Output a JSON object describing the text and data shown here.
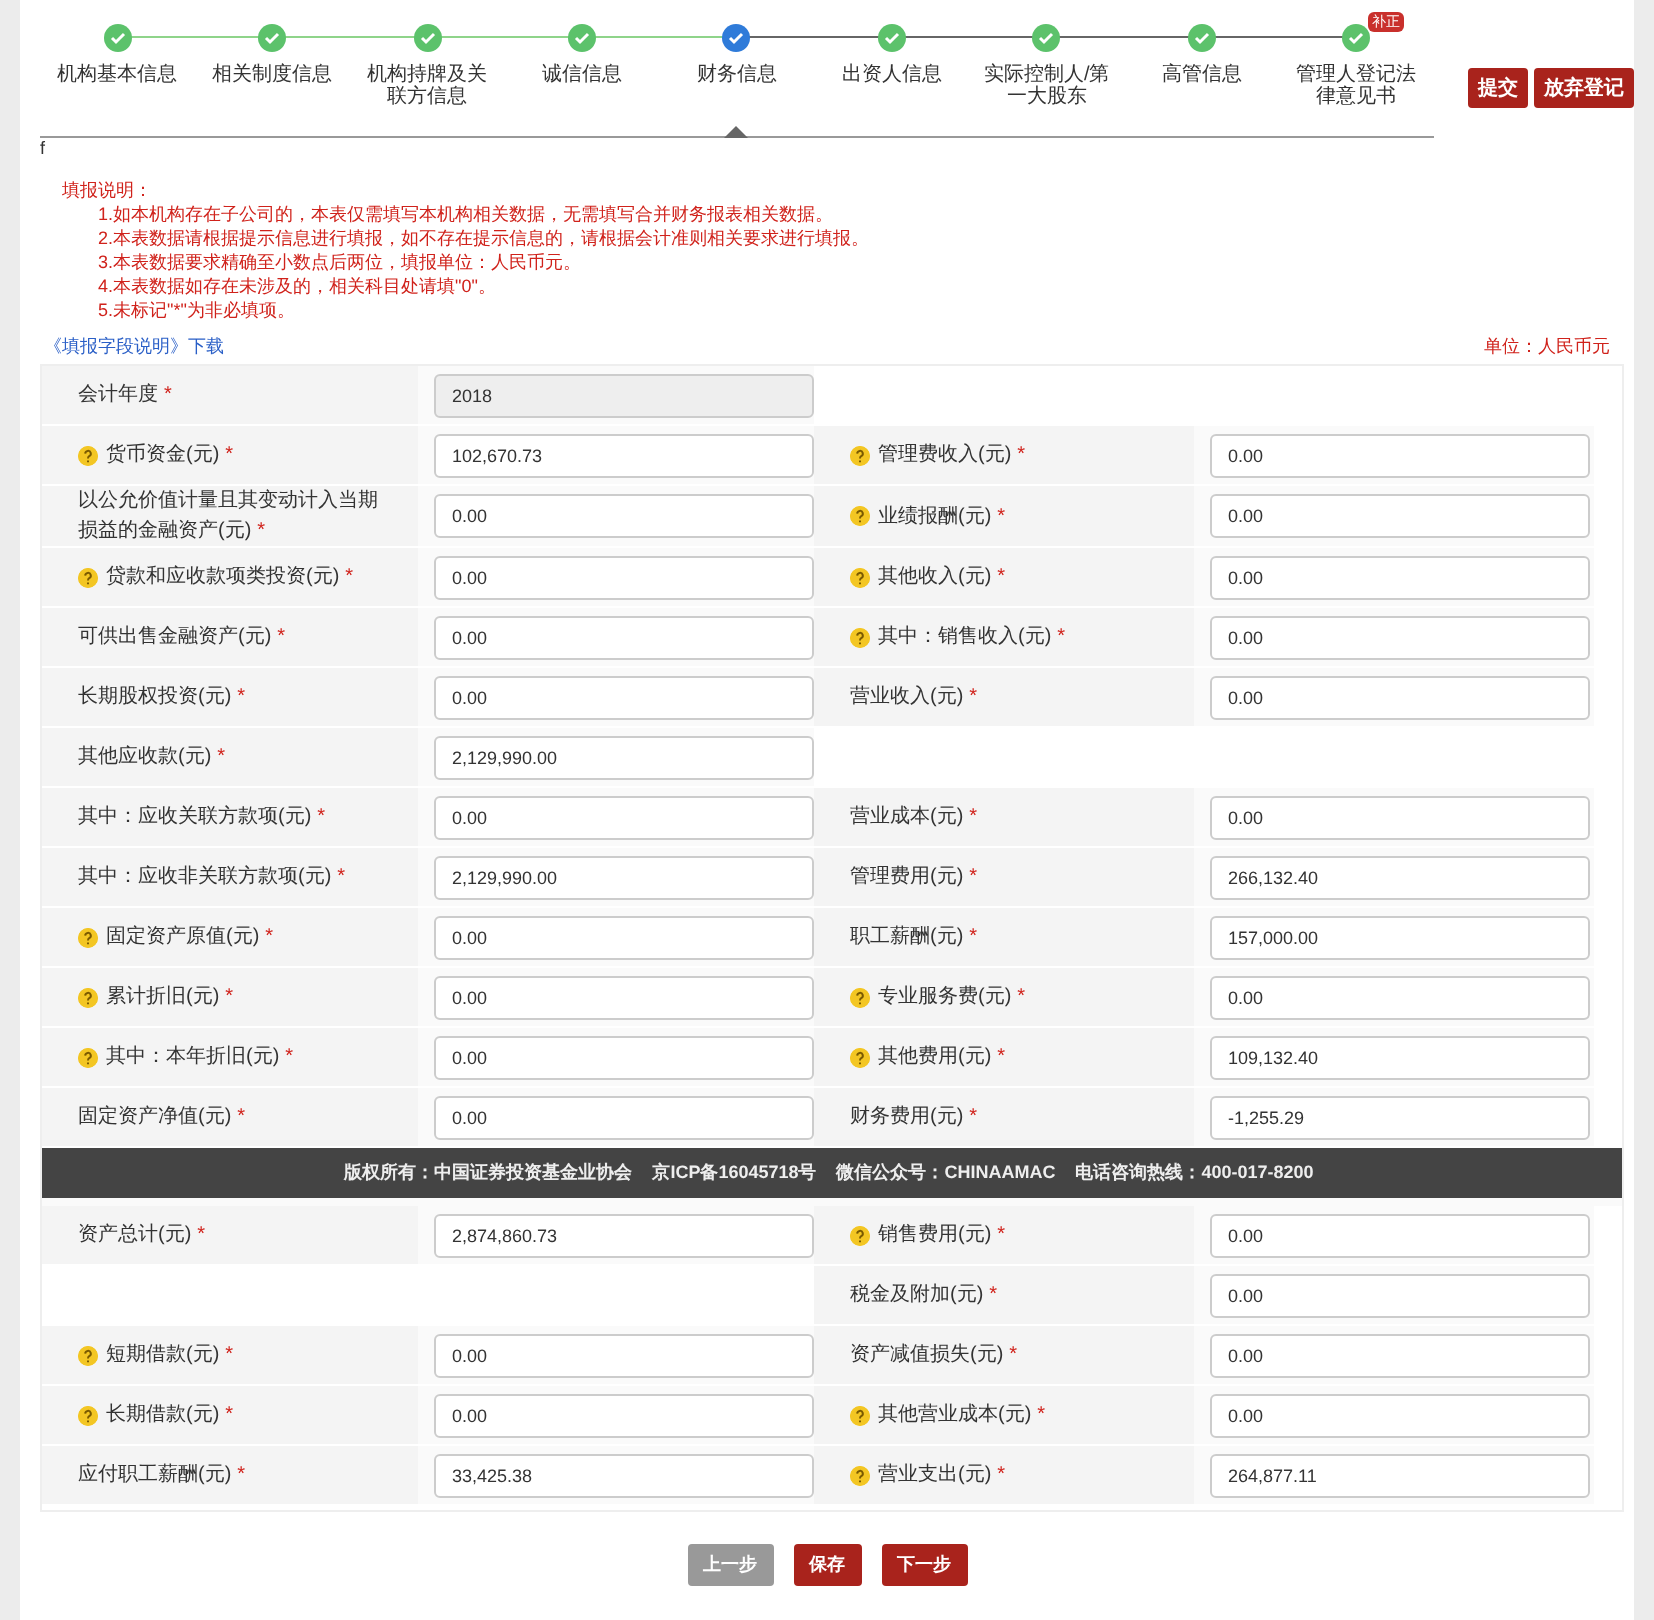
{
  "steps": [
    {
      "label": "机构基本信息",
      "kind": "done"
    },
    {
      "label": "相关制度信息",
      "kind": "done"
    },
    {
      "label": "机构持牌及关联方信息",
      "kind": "done"
    },
    {
      "label": "诚信信息",
      "kind": "done"
    },
    {
      "label": "财务信息",
      "kind": "current"
    },
    {
      "label": "出资人信息",
      "kind": "done"
    },
    {
      "label": "实际控制人/第一大股东",
      "kind": "done"
    },
    {
      "label": "高管信息",
      "kind": "done"
    },
    {
      "label": "管理人登记法律意见书",
      "kind": "done",
      "badge": "补正"
    }
  ],
  "actions": [
    "提交",
    "放弃登记"
  ],
  "stray_text": "f",
  "instructions": {
    "title": "填报说明：",
    "items": [
      "1.如本机构存在子公司的，本表仅需填写本机构相关数据，无需填写合并财务报表相关数据。",
      "2.本表数据请根据提示信息进行填报，如不存在提示信息的，请根据会计准则相关要求进行填报。",
      "3.本表数据要求精确至小数点后两位，填报单位：人民币元。",
      "4.本表数据如存在未涉及的，相关科目处请填\"0\"。",
      "5.未标记\"*\"为非必填项。"
    ]
  },
  "download_link": "《填报字段说明》下载",
  "unit": "单位：人民币元",
  "table": {
    "sections": [
      {
        "rows": [
          {
            "left": {
              "label": "会计年度",
              "required_mark": "*",
              "help": false,
              "value": "2018",
              "disabled": true
            }
          },
          {
            "left": {
              "label": "货币资金(元)",
              "required_mark": "*",
              "help": true,
              "value": "102,670.73"
            },
            "right": {
              "label": "管理费收入(元)",
              "required_mark": "*",
              "help": true,
              "value": "0.00"
            }
          },
          {
            "left": {
              "label": "以公允价值计量且其变动计入当期损益的金融资产(元)",
              "required_mark": "*",
              "help": false,
              "value": "0.00"
            },
            "right": {
              "label": "业绩报酬(元)",
              "required_mark": "*",
              "help": true,
              "value": "0.00"
            }
          },
          {
            "left": {
              "label": "贷款和应收款项类投资(元)",
              "required_mark": "*",
              "help": true,
              "value": "0.00"
            },
            "right": {
              "label": "其他收入(元)",
              "required_mark": "*",
              "help": true,
              "value": "0.00"
            }
          },
          {
            "left": {
              "label": "可供出售金融资产(元)",
              "required_mark": "*",
              "help": false,
              "value": "0.00"
            },
            "right": {
              "label": "其中：销售收入(元)",
              "required_mark": "*",
              "help": true,
              "value": "0.00"
            }
          },
          {
            "left": {
              "label": "长期股权投资(元)",
              "required_mark": "*",
              "help": false,
              "value": "0.00"
            },
            "right": {
              "label": "营业收入(元)",
              "required_mark": "*",
              "help": false,
              "value": "0.00"
            }
          },
          {
            "left": {
              "label": "其他应收款(元)",
              "required_mark": "*",
              "help": false,
              "value": "2,129,990.00"
            }
          },
          {
            "left": {
              "label": "其中：应收关联方款项(元)",
              "required_mark": "*",
              "help": false,
              "value": "0.00"
            },
            "right": {
              "label": "营业成本(元)",
              "required_mark": "*",
              "help": false,
              "value": "0.00"
            }
          },
          {
            "left": {
              "label": "其中：应收非关联方款项(元)",
              "required_mark": "*",
              "help": false,
              "value": "2,129,990.00"
            },
            "right": {
              "label": "管理费用(元)",
              "required_mark": "*",
              "help": false,
              "value": "266,132.40"
            }
          },
          {
            "left": {
              "label": "固定资产原值(元)",
              "required_mark": "*",
              "help": true,
              "value": "0.00"
            },
            "right": {
              "label": "职工薪酬(元)",
              "required_mark": "*",
              "help": false,
              "value": "157,000.00"
            }
          },
          {
            "left": {
              "label": "累计折旧(元)",
              "required_mark": "*",
              "help": true,
              "value": "0.00"
            },
            "right": {
              "label": "专业服务费(元)",
              "required_mark": "*",
              "help": true,
              "value": "0.00"
            }
          },
          {
            "left": {
              "label": "其中：本年折旧(元)",
              "required_mark": "*",
              "help": true,
              "value": "0.00"
            },
            "right": {
              "label": "其他费用(元)",
              "required_mark": "*",
              "help": true,
              "value": "109,132.40"
            }
          },
          {
            "left": {
              "label": "固定资产净值(元)",
              "required_mark": "*",
              "help": false,
              "value": "0.00"
            },
            "right": {
              "label": "财务费用(元)",
              "required_mark": "*",
              "help": false,
              "value": "-1,255.29"
            }
          }
        ]
      },
      {
        "rows": [
          {
            "left": {
              "label": "资产总计(元)",
              "required_mark": "*",
              "help": false,
              "value": "2,874,860.73"
            },
            "right": {
              "label": "销售费用(元)",
              "required_mark": "*",
              "help": true,
              "value": "0.00"
            }
          },
          {
            "right": {
              "label": "税金及附加(元)",
              "required_mark": "*",
              "help": false,
              "value": "0.00"
            }
          },
          {
            "left": {
              "label": "短期借款(元)",
              "required_mark": "*",
              "help": true,
              "value": "0.00"
            },
            "right": {
              "label": "资产减值损失(元)",
              "required_mark": "*",
              "help": false,
              "value": "0.00"
            }
          },
          {
            "left": {
              "label": "长期借款(元)",
              "required_mark": "*",
              "help": true,
              "value": "0.00"
            },
            "right": {
              "label": "其他营业成本(元)",
              "required_mark": "*",
              "help": true,
              "value": "0.00"
            }
          },
          {
            "left": {
              "label": "应付职工薪酬(元)",
              "required_mark": "*",
              "help": false,
              "value": "33,425.38"
            },
            "right": {
              "label": "营业支出(元)",
              "required_mark": "*",
              "help": true,
              "value": "264,877.11"
            }
          }
        ]
      }
    ]
  },
  "footer_bar": [
    "版权所有：中国证券投资基金业协会",
    "京ICP备16045718号",
    "微信公众号：CHINAAMAC",
    "电话咨询热线：400-017-8200"
  ],
  "nav_buttons": [
    {
      "label": "上一步",
      "disabled": true
    },
    {
      "label": "保存",
      "disabled": false
    },
    {
      "label": "下一步",
      "disabled": false
    }
  ]
}
